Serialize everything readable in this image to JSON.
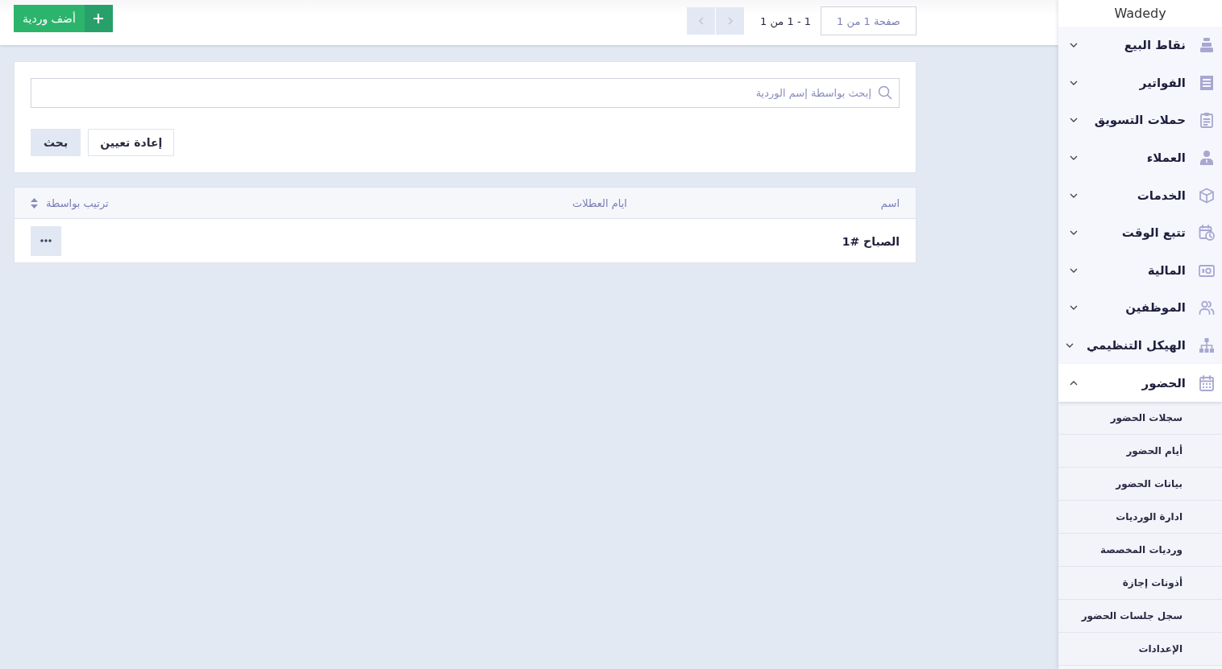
{
  "sidebar": {
    "logo": "Wadedy",
    "items": [
      {
        "label": "نقاط البيع",
        "expanded": false
      },
      {
        "label": "الفواتير",
        "expanded": false
      },
      {
        "label": "حملات التسويق",
        "expanded": false
      },
      {
        "label": "العملاء",
        "expanded": false
      },
      {
        "label": "الخدمات",
        "expanded": false
      },
      {
        "label": "تتبع الوقت",
        "expanded": false
      },
      {
        "label": "المالية",
        "expanded": false
      },
      {
        "label": "الموظفين",
        "expanded": false
      },
      {
        "label": "الهيكل التنظيمي",
        "expanded": false
      },
      {
        "label": "الحضور",
        "expanded": true,
        "children": [
          {
            "label": "سجلات الحضور"
          },
          {
            "label": "أيام الحضور"
          },
          {
            "label": "بيانات الحضور"
          },
          {
            "label": "ادارة الورديات"
          },
          {
            "label": "ورديات المخصصة"
          },
          {
            "label": "أذونات إجازة"
          },
          {
            "label": "سجل جلسات الحضور"
          },
          {
            "label": "الإعدادات"
          }
        ]
      }
    ]
  },
  "top_bar": {
    "pagination": {
      "page_info": "صفحة 1 من 1",
      "range": "1 - 1 من 1",
      "prev_button": {
        "disabled": true
      },
      "next_button": {
        "disabled": true
      }
    },
    "add_button": {
      "label": "أضف وردية"
    }
  },
  "search_panel": {
    "search_field": {
      "placeholder": "إبحث بواسطة إسم الوردية"
    },
    "buttons": [
      {
        "label": "إعادة تعيين",
        "kind": "outline"
      },
      {
        "label": "بحث",
        "kind": "filled"
      }
    ]
  },
  "table": {
    "columns": [
      {
        "label": "اسم"
      },
      {
        "label": "ايام العطلات"
      }
    ],
    "sort": {
      "label": "ترتيب بواسطة"
    },
    "rows": [
      {
        "name": "الصباح #1"
      }
    ]
  }
}
